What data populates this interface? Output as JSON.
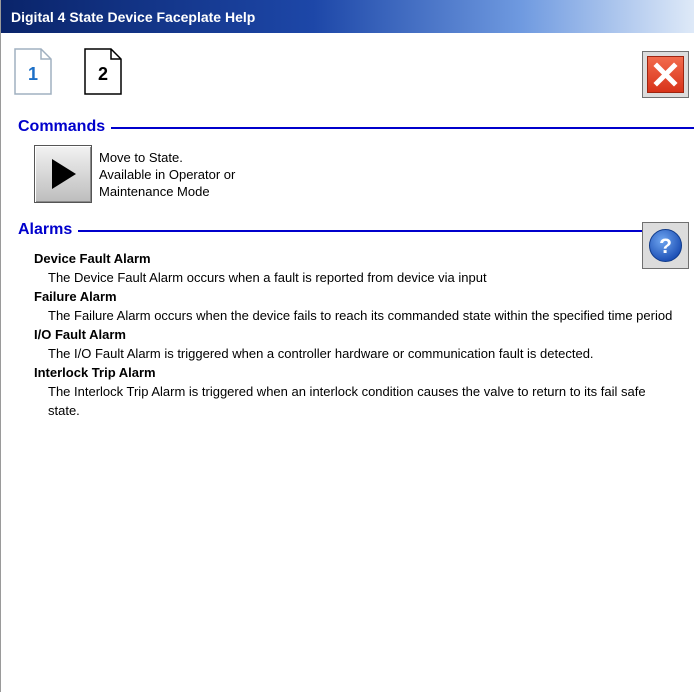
{
  "window": {
    "title": "Digital 4 State Device Faceplate Help"
  },
  "pages": [
    {
      "label": "1",
      "active": true
    },
    {
      "label": "2",
      "active": false
    }
  ],
  "icons": {
    "close": "close-icon",
    "help": "help-icon",
    "play": "play-icon",
    "page": "page-icon"
  },
  "colors": {
    "section_header": "#0000cc",
    "active_page": "#1c6fc7",
    "close_button": "#e0442a",
    "help_button": "#1f5fc8"
  },
  "commands": {
    "header": "Commands",
    "items": [
      {
        "lines": [
          "Move to State.",
          "Available in Operator or",
          "Maintenance Mode"
        ]
      }
    ]
  },
  "alarms": {
    "header": "Alarms",
    "items": [
      {
        "name": "Device Fault Alarm",
        "description": "The Device Fault Alarm occurs when a fault is reported from device via input"
      },
      {
        "name": "Failure Alarm",
        "description": "The Failure Alarm occurs when the device fails to reach its commanded state within the specified time period"
      },
      {
        "name": "I/O Fault Alarm",
        "description": "The I/O Fault Alarm is triggered when a controller hardware or communication fault is detected."
      },
      {
        "name": "Interlock Trip Alarm",
        "description": "The Interlock Trip Alarm is triggered when an interlock condition causes the valve to return to its fail safe state."
      }
    ]
  }
}
